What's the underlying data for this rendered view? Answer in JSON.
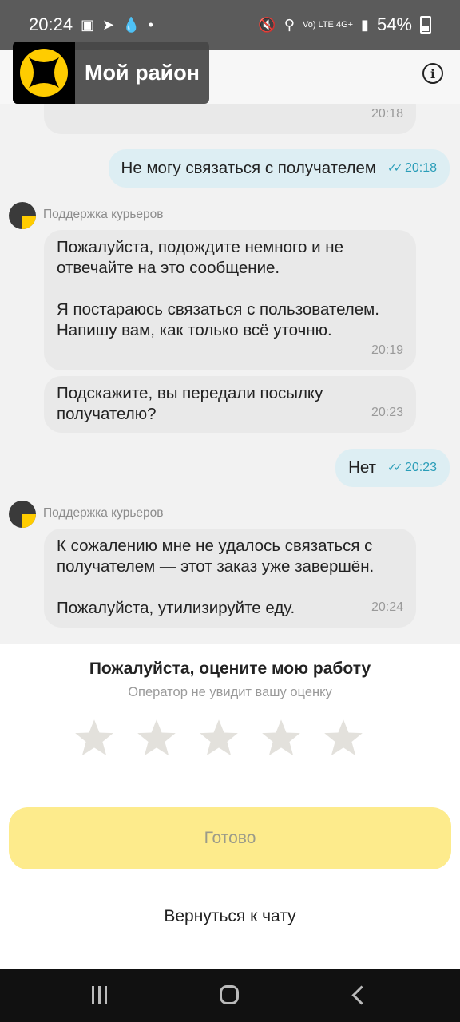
{
  "status_bar": {
    "time": "20:24",
    "network": "Vo) LTE 4G+",
    "battery": "54%"
  },
  "header": {
    "title": "Мой район",
    "info_icon": "info-icon"
  },
  "messages": {
    "partial_time": "20:18",
    "out1": {
      "text": "Не могу связаться с получателем",
      "time": "20:18"
    },
    "support1": {
      "sender": "Поддержка курьеров",
      "b1_text": "Пожалуйста, подождите немного и не отвечайте на это сообщение.\n\nЯ постараюсь связаться с пользователем. Напишу вам, как только всё уточню.",
      "b1_time": "20:19",
      "b2_text": "Подскажите, вы передали посылку получателю?",
      "b2_time": "20:23"
    },
    "out2": {
      "text": "Нет",
      "time": "20:23"
    },
    "support2": {
      "sender": "Поддержка курьеров",
      "b1_text": "К сожалению мне не удалось связаться с получателем — этот заказ уже завершён.\n\nПожалуйста, утилизируйте еду.",
      "b1_time": "20:24"
    }
  },
  "rating": {
    "title": "Пожалуйста, оцените мою работу",
    "subtitle": "Оператор не увидит вашу оценку",
    "selected": 0,
    "max": 5
  },
  "actions": {
    "done": "Готово",
    "back_to_chat": "Вернуться к чату"
  },
  "colors": {
    "accent_yellow": "#ffcc00",
    "button_yellow": "#fdeb8c",
    "outgoing_bubble": "#ddeef3",
    "incoming_bubble": "#e9e9e9",
    "read_tick": "#2a9db8"
  }
}
